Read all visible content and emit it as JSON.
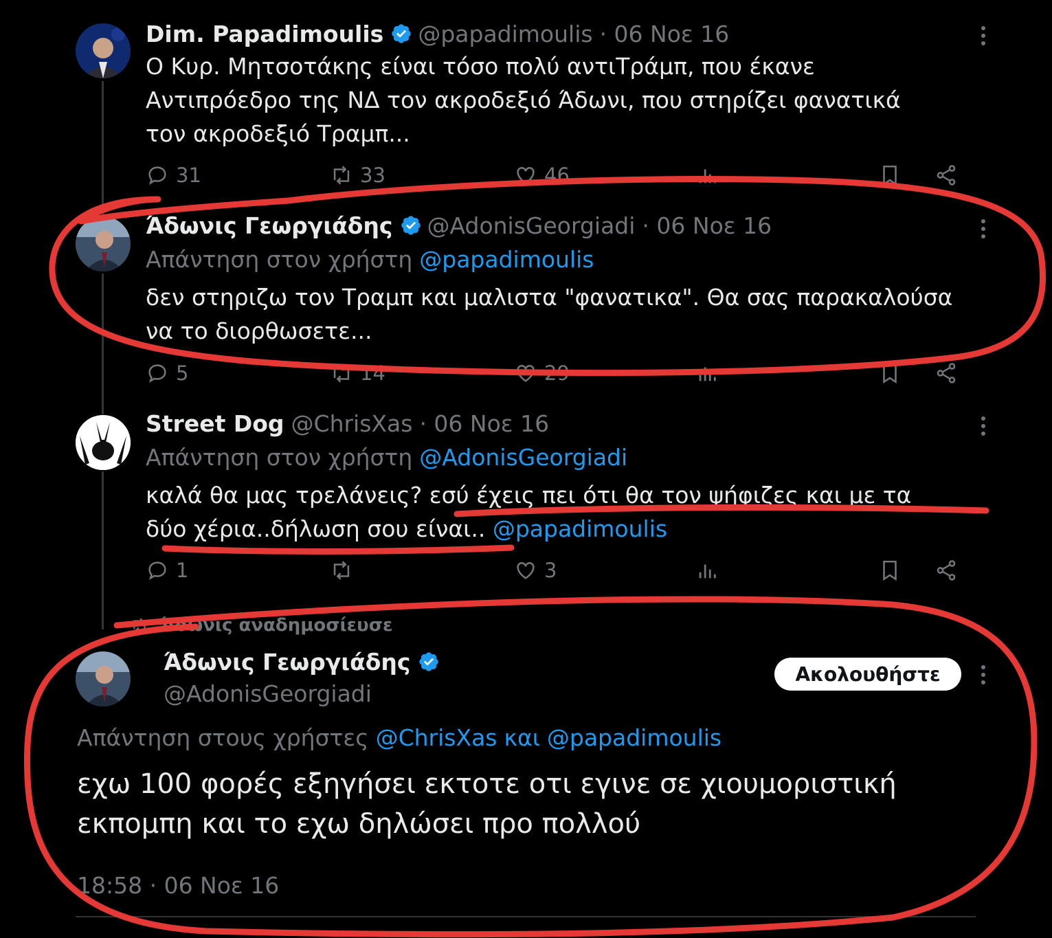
{
  "tweets": [
    {
      "name": "Dim. Papadimoulis",
      "handle": "@papadimoulis",
      "date": "· 06 Νοε 16",
      "lines": [
        "Ο Κυρ. Μητσοτάκης είναι τόσο πολύ αντιΤράμπ, που έκανε",
        "Αντιπρόεδρο της ΝΔ τον ακροδεξιό Άδωνι, που στηρίζει φανατικά",
        "τον ακροδεξιό Τραμπ..."
      ],
      "replies": "31",
      "retweets": "33",
      "likes": "46"
    },
    {
      "name": "Άδωνις Γεωργιάδης",
      "handle": "@AdonisGeorgiadi",
      "date": "· 06 Νοε 16",
      "reply_prefix": "Απάντηση στον χρήστη",
      "reply_to": "@papadimoulis",
      "lines": [
        "δεν στηριζω τον Τραμπ και μαλιστα \"φανατικα\". Θα σας παρακαλούσα",
        "να το διορθωσετε..."
      ],
      "replies": "5",
      "retweets": "14",
      "likes": "29"
    },
    {
      "name": "Street Dog",
      "handle": "@ChrisXas",
      "date": "· 06 Νοε 16",
      "reply_prefix": "Απάντηση στον χρήστη",
      "reply_to": "@AdonisGeorgiadi",
      "line1": "καλά θα μας τρελάνεις? εσύ έχεις πει ότι θα τον ψήφιζες και με τα",
      "line2": "δύο χέρια..δήλωση σου είναι.. ",
      "line2_mention": "@papadimoulis",
      "replies": "1",
      "likes": "3"
    }
  ],
  "repost_label": "Άδωνις αναδημοσίευσε",
  "main_tweet": {
    "name": "Άδωνις Γεωργιάδης",
    "handle": "@AdonisGeorgiadi",
    "follow_label": "Ακολουθήστε",
    "reply_prefix": "Απάντηση στους χρήστες",
    "reply_to_1": "@ChrisXas",
    "reply_and": "και",
    "reply_to_2": "@papadimoulis",
    "lines": [
      "εχω 100 φορές εξηγήσει εκτοτε οτι εγινε σε χιουμοριστική",
      "εκπομπη και το εχω δηλώσει προ πολλού"
    ],
    "timestamp": "18:58 · 06 Νοε 16"
  },
  "colors": {
    "background": "#000000",
    "text": "#e7e9ea",
    "muted": "#71767b",
    "link": "#1d9bf0",
    "verified": "#1d9bf0",
    "annotation": "#e53935"
  }
}
